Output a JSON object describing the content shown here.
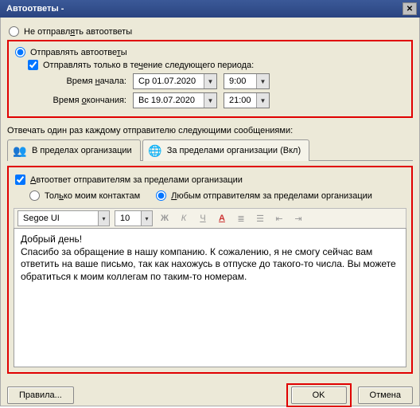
{
  "titlebar": {
    "title": "Автоответы -"
  },
  "opt": {
    "dont_send": "Не отправлять автоответы",
    "send": "Отправлять автоответы",
    "period_check": "Отправлять только в течение следующего периода:",
    "start_label": "Время начала:",
    "end_label": "Время окончания:",
    "start_date": "Ср 01.07.2020",
    "start_time": "9:00",
    "end_date": "Вс 19.07.2020",
    "end_time": "21:00"
  },
  "section_label": "Отвечать один раз каждому отправителю следующими сообщениями:",
  "tabs": {
    "inside": "В пределах организации",
    "outside": "За пределами организации (Вкл)"
  },
  "outside": {
    "enable": "Автоответ отправителям за пределами организации",
    "only_contacts": "Только моим контактам",
    "any_sender": "Любым отправителям за пределами организации"
  },
  "toolbar": {
    "font": "Segoe UI",
    "size": "10",
    "bold": "Ж",
    "italic": "К",
    "underline": "Ч",
    "color": "А"
  },
  "message": "Добрый день!\nСпасибо за обращение в нашу компанию. К сожалению, я не смогу сейчас вам ответить на ваше письмо, так как нахожусь в отпуске до такого-то числа. Вы можете обратиться к моим коллегам по таким-то номерам.",
  "buttons": {
    "rules": "Правила...",
    "ok": "OK",
    "cancel": "Отмена"
  }
}
